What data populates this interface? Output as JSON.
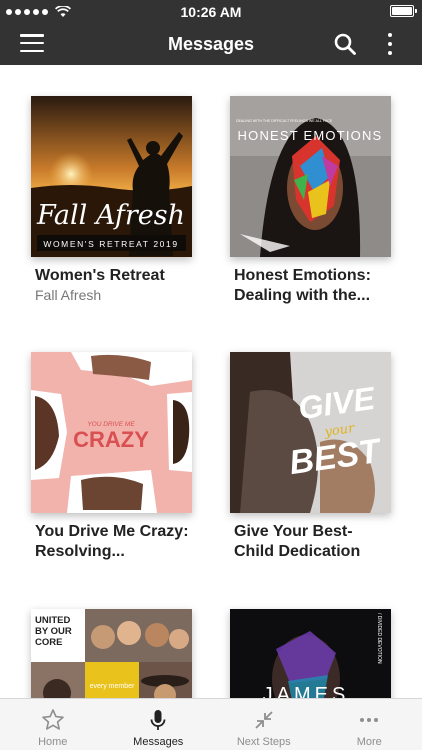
{
  "status_bar": {
    "time": "10:26 AM"
  },
  "nav": {
    "title": "Messages"
  },
  "cards": [
    {
      "title": "Women's Retreat",
      "subtitle": "Fall Afresh",
      "art_title": "Fall Afresh",
      "art_subtitle": "WOMEN'S RETREAT 2019"
    },
    {
      "title": "Honest Emotions: Dealing with the...",
      "art_title": "HONEST EMOTIONS",
      "art_subtitle": "DEALING WITH THE DIFFICULT FEELINGS WE ALL FACE"
    },
    {
      "title": "You Drive Me Crazy: Resolving...",
      "art_title": "CRAZY",
      "art_subtitle": "YOU DRIVE ME"
    },
    {
      "title": "Give Your Best- Child Dedication",
      "art_title_top": "GIVE",
      "art_title_mid": "your",
      "art_title_bottom": "BEST"
    },
    {
      "art_title": "UNITED BY OUR CORE",
      "art_badge": "every member"
    },
    {
      "art_title": "JAMES",
      "art_subtitle": "/ DIVIDED DEVOTION"
    }
  ],
  "tabs": [
    {
      "label": "Home",
      "icon": "star-icon",
      "active": false
    },
    {
      "label": "Messages",
      "icon": "microphone-icon",
      "active": true
    },
    {
      "label": "Next Steps",
      "icon": "collapse-arrows-icon",
      "active": false
    },
    {
      "label": "More",
      "icon": "ellipsis-icon",
      "active": false
    }
  ],
  "colors": {
    "header": "#333333",
    "tab_active": "#222222",
    "tab_inactive": "#8e8e8e",
    "badge_yellow": "#e9c21b",
    "pink": "#f2b3ad"
  }
}
